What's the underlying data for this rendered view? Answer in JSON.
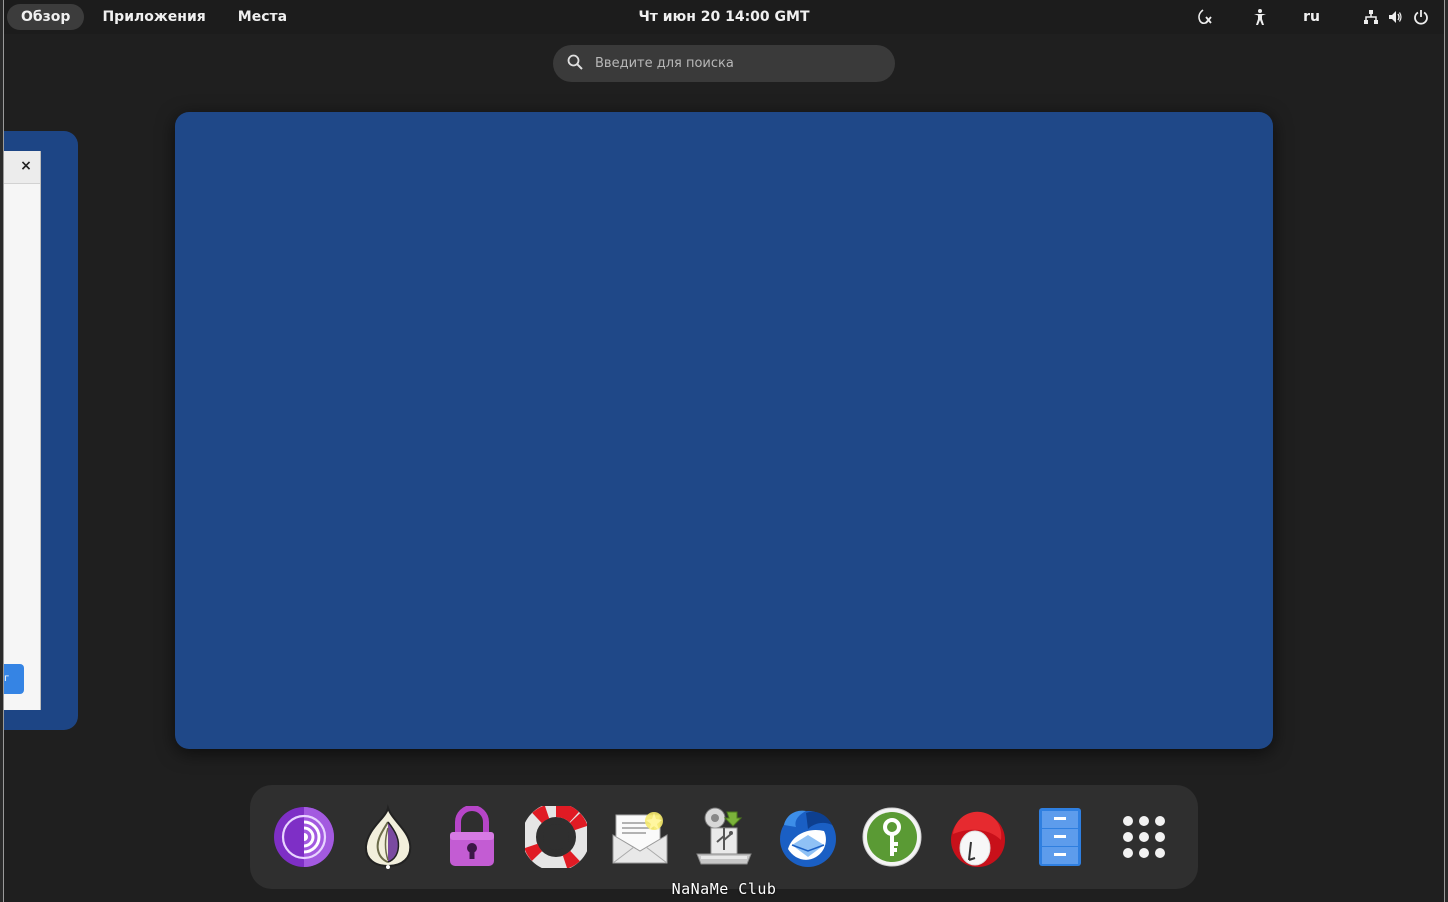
{
  "topbar": {
    "activities": "Обзор",
    "applications": "Приложения",
    "places": "Места",
    "clock": "Чт июн 20  14:00 GMT",
    "language": "ru"
  },
  "search": {
    "placeholder": "Введите для поиска"
  },
  "left_window": {
    "close_glyph": "×",
    "button_text": "г"
  },
  "dock": {
    "items": [
      {
        "icon": "tor-browser-icon"
      },
      {
        "icon": "onion-share-icon"
      },
      {
        "icon": "password-lock-icon"
      },
      {
        "icon": "help-lifebuoy-icon"
      },
      {
        "icon": "new-mail-icon"
      },
      {
        "icon": "usb-installer-icon"
      },
      {
        "icon": "thunderbird-icon"
      },
      {
        "icon": "keepassxc-icon"
      },
      {
        "icon": "redhat-app-icon"
      },
      {
        "icon": "files-cabinet-icon"
      },
      {
        "icon": "show-apps-grid-icon"
      }
    ]
  },
  "watermark": "NaNaMe Club",
  "colors": {
    "workspace": "#1f4888",
    "panel": "#1c1c1c",
    "dock": "#2f2f2f",
    "accent": "#3584e4"
  }
}
